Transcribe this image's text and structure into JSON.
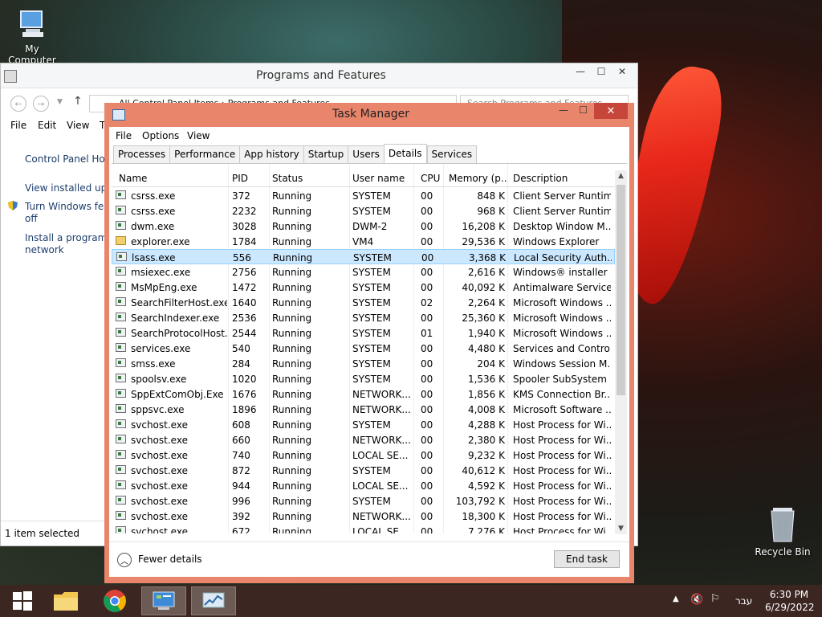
{
  "desktop": {
    "my_computer_label": "My Computer",
    "recycle_bin_label": "Recycle Bin"
  },
  "programs_features": {
    "title": "Programs and Features",
    "address": "All Control Panel Items  ›  Programs and Features",
    "search_placeholder": "Search Programs and Features",
    "menu": [
      "File",
      "Edit",
      "View",
      "T"
    ],
    "side_links": [
      "Control Panel Hom",
      "View installed upda",
      "Turn Windows feat",
      "off",
      "Install a program fr",
      "network"
    ],
    "status": "1 item selected"
  },
  "task_manager": {
    "title": "Task Manager",
    "menu": [
      "File",
      "Options",
      "View"
    ],
    "tabs": [
      "Processes",
      "Performance",
      "App history",
      "Startup",
      "Users",
      "Details",
      "Services"
    ],
    "active_tab": "Details",
    "columns": [
      "Name",
      "PID",
      "Status",
      "User name",
      "CPU",
      "Memory (p...",
      "Description"
    ],
    "rows": [
      {
        "name": "csrss.exe",
        "pid": "372",
        "status": "Running",
        "user": "SYSTEM",
        "cpu": "00",
        "mem": "848 K",
        "desc": "Client Server Runtim...",
        "icon": "process-icon"
      },
      {
        "name": "csrss.exe",
        "pid": "2232",
        "status": "Running",
        "user": "SYSTEM",
        "cpu": "00",
        "mem": "968 K",
        "desc": "Client Server Runtim...",
        "icon": "process-icon"
      },
      {
        "name": "dwm.exe",
        "pid": "3028",
        "status": "Running",
        "user": "DWM-2",
        "cpu": "00",
        "mem": "16,208 K",
        "desc": "Desktop Window M...",
        "icon": "process-icon"
      },
      {
        "name": "explorer.exe",
        "pid": "1784",
        "status": "Running",
        "user": "VM4",
        "cpu": "00",
        "mem": "29,536 K",
        "desc": "Windows Explorer",
        "icon": "folder-icon"
      },
      {
        "name": "lsass.exe",
        "pid": "556",
        "status": "Running",
        "user": "SYSTEM",
        "cpu": "00",
        "mem": "3,368 K",
        "desc": "Local Security Auth...",
        "icon": "process-icon",
        "selected": true
      },
      {
        "name": "msiexec.exe",
        "pid": "2756",
        "status": "Running",
        "user": "SYSTEM",
        "cpu": "00",
        "mem": "2,616 K",
        "desc": "Windows® installer",
        "icon": "installer-icon"
      },
      {
        "name": "MsMpEng.exe",
        "pid": "1472",
        "status": "Running",
        "user": "SYSTEM",
        "cpu": "00",
        "mem": "40,092 K",
        "desc": "Antimalware Service...",
        "icon": "process-icon"
      },
      {
        "name": "SearchFilterHost.exe",
        "pid": "1640",
        "status": "Running",
        "user": "SYSTEM",
        "cpu": "02",
        "mem": "2,264 K",
        "desc": "Microsoft Windows ...",
        "icon": "search-icon"
      },
      {
        "name": "SearchIndexer.exe",
        "pid": "2536",
        "status": "Running",
        "user": "SYSTEM",
        "cpu": "00",
        "mem": "25,360 K",
        "desc": "Microsoft Windows ...",
        "icon": "search-icon"
      },
      {
        "name": "SearchProtocolHost....",
        "pid": "2544",
        "status": "Running",
        "user": "SYSTEM",
        "cpu": "01",
        "mem": "1,940 K",
        "desc": "Microsoft Windows ...",
        "icon": "search-icon"
      },
      {
        "name": "services.exe",
        "pid": "540",
        "status": "Running",
        "user": "SYSTEM",
        "cpu": "00",
        "mem": "4,480 K",
        "desc": "Services and Control...",
        "icon": "process-icon"
      },
      {
        "name": "smss.exe",
        "pid": "284",
        "status": "Running",
        "user": "SYSTEM",
        "cpu": "00",
        "mem": "204 K",
        "desc": "Windows Session M...",
        "icon": "process-icon"
      },
      {
        "name": "spoolsv.exe",
        "pid": "1020",
        "status": "Running",
        "user": "SYSTEM",
        "cpu": "00",
        "mem": "1,536 K",
        "desc": "Spooler SubSystem ...",
        "icon": "printer-icon"
      },
      {
        "name": "SppExtComObj.Exe",
        "pid": "1676",
        "status": "Running",
        "user": "NETWORK...",
        "cpu": "00",
        "mem": "1,856 K",
        "desc": "KMS Connection Br...",
        "icon": "process-icon"
      },
      {
        "name": "sppsvc.exe",
        "pid": "1896",
        "status": "Running",
        "user": "NETWORK...",
        "cpu": "00",
        "mem": "4,008 K",
        "desc": "Microsoft Software ...",
        "icon": "process-icon"
      },
      {
        "name": "svchost.exe",
        "pid": "608",
        "status": "Running",
        "user": "SYSTEM",
        "cpu": "00",
        "mem": "4,288 K",
        "desc": "Host Process for Wi...",
        "icon": "process-icon"
      },
      {
        "name": "svchost.exe",
        "pid": "660",
        "status": "Running",
        "user": "NETWORK...",
        "cpu": "00",
        "mem": "2,380 K",
        "desc": "Host Process for Wi...",
        "icon": "process-icon"
      },
      {
        "name": "svchost.exe",
        "pid": "740",
        "status": "Running",
        "user": "LOCAL SE...",
        "cpu": "00",
        "mem": "9,232 K",
        "desc": "Host Process for Wi...",
        "icon": "process-icon"
      },
      {
        "name": "svchost.exe",
        "pid": "872",
        "status": "Running",
        "user": "SYSTEM",
        "cpu": "00",
        "mem": "40,612 K",
        "desc": "Host Process for Wi...",
        "icon": "process-icon"
      },
      {
        "name": "svchost.exe",
        "pid": "944",
        "status": "Running",
        "user": "LOCAL SE...",
        "cpu": "00",
        "mem": "4,592 K",
        "desc": "Host Process for Wi...",
        "icon": "process-icon"
      },
      {
        "name": "svchost.exe",
        "pid": "996",
        "status": "Running",
        "user": "SYSTEM",
        "cpu": "00",
        "mem": "103,792 K",
        "desc": "Host Process for Wi...",
        "icon": "process-icon"
      },
      {
        "name": "svchost.exe",
        "pid": "392",
        "status": "Running",
        "user": "NETWORK...",
        "cpu": "00",
        "mem": "18,300 K",
        "desc": "Host Process for Wi...",
        "icon": "process-icon"
      },
      {
        "name": "svchost.exe",
        "pid": "672",
        "status": "Running",
        "user": "LOCAL SE...",
        "cpu": "00",
        "mem": "7,276 K",
        "desc": "Host Process for Wi...",
        "icon": "process-icon"
      }
    ],
    "fewer_details": "Fewer details",
    "end_task": "End task"
  },
  "taskbar": {
    "language": "עבר",
    "time": "6:30 PM",
    "date": "6/29/2022"
  }
}
